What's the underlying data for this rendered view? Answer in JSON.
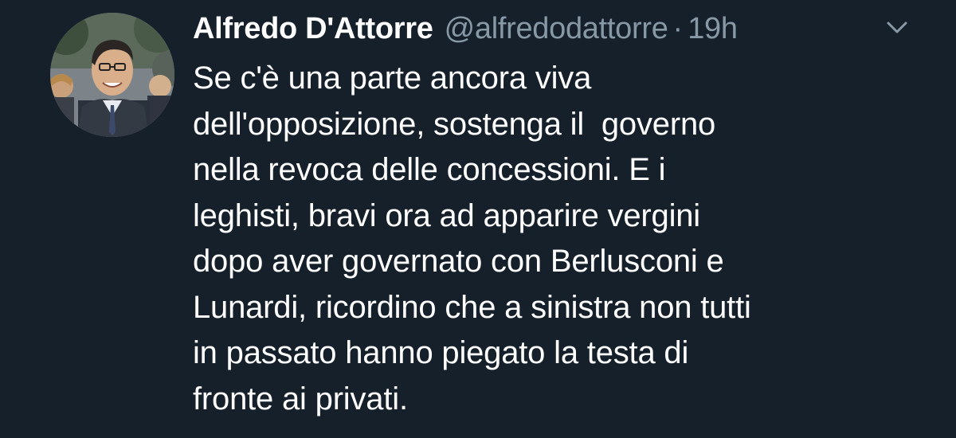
{
  "tweet": {
    "author": {
      "name": "Alfredo D'Attorre",
      "handle": "@alfredodattorre",
      "avatar_icon": "profile-photo"
    },
    "separator": "·",
    "timestamp": "19h",
    "menu_icon": "chevron-down-icon",
    "text_lines": [
      "Se c'è una parte ancora viva",
      "dell'opposizione, sostenga il  governo",
      "nella revoca delle concessioni. E i",
      "leghisti, bravi ora ad apparire vergini",
      "dopo aver governato con Berlusconi e",
      "Lunardi, ricordino che a sinistra non tutti",
      "in passato hanno piegato la testa di",
      "fronte ai privati."
    ]
  },
  "colors": {
    "background": "#15202b",
    "primary_text": "#ffffff",
    "secondary_text": "#8899a6"
  }
}
